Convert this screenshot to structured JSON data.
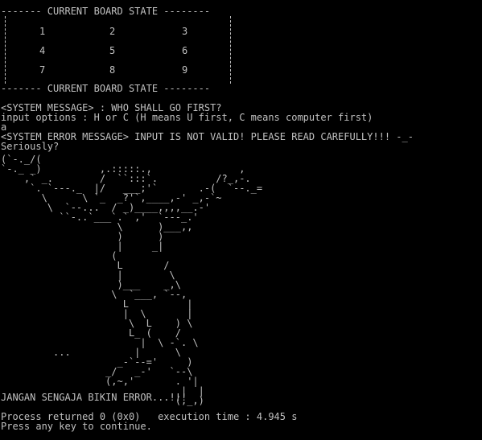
{
  "board": {
    "header": "------- CURRENT BOARD STATE --------",
    "footer": "------- CURRENT BOARD STATE --------",
    "rows": [
      [
        "1",
        "2",
        "3"
      ],
      [
        "4",
        "5",
        "6"
      ],
      [
        "7",
        "8",
        "9"
      ]
    ]
  },
  "messages": {
    "system_prompt": "<SYSTEM MESSAGE> : WHO SHALL GO FIRST?",
    "input_options": "input options : H or C (H means U first, C means computer first)",
    "user_input": "a",
    "error_message": "<SYSTEM ERROR MESSAGE> INPUT IS NOT VALID! PLEASE READ CAREFULLY!!! -_-",
    "seriously": "Seriously?"
  },
  "ascii_art": "(`-._/(\n`-._ _)          ,.:::::.,               ,\n    ,` _.        /  ``:::`.          /?_,-.\n     `. `---._  |/   ___;'`       .-(  `--._=\n       \\      \\ `_  _?'`,____,-' _,-`~\n        \\  `--...  / _)____,,,,__.-'\n          ``-..`___`.` ,'  `---_.'\n                    \\      )___,,\n                    )      )\n                    |     _|\n                   (\n                    L       /\n                    |        \\\n                    )___    _,\\\n                   \\  `___, `--,\n                     L          |\n                     |  \\       |\n                      \\  L    ) \\\n                      L_ (    /\n                        |  \\ -`. \\\n         ...           |      \\\n                    _-`--='     )\n                  _/   _-'   `--\\\n                  (,~,'       . '|\n                               |  |\n                              (,_,)",
  "footer": {
    "taunt": "JANGAN SENGAJA BIKIN ERROR...!!!",
    "process_returned": "Process returned 0 (0x0)   execution time : 4.945 s",
    "press_any_key": "Press any key to continue."
  },
  "colors": {
    "background": "#000000",
    "text": "#c0c0c0"
  }
}
